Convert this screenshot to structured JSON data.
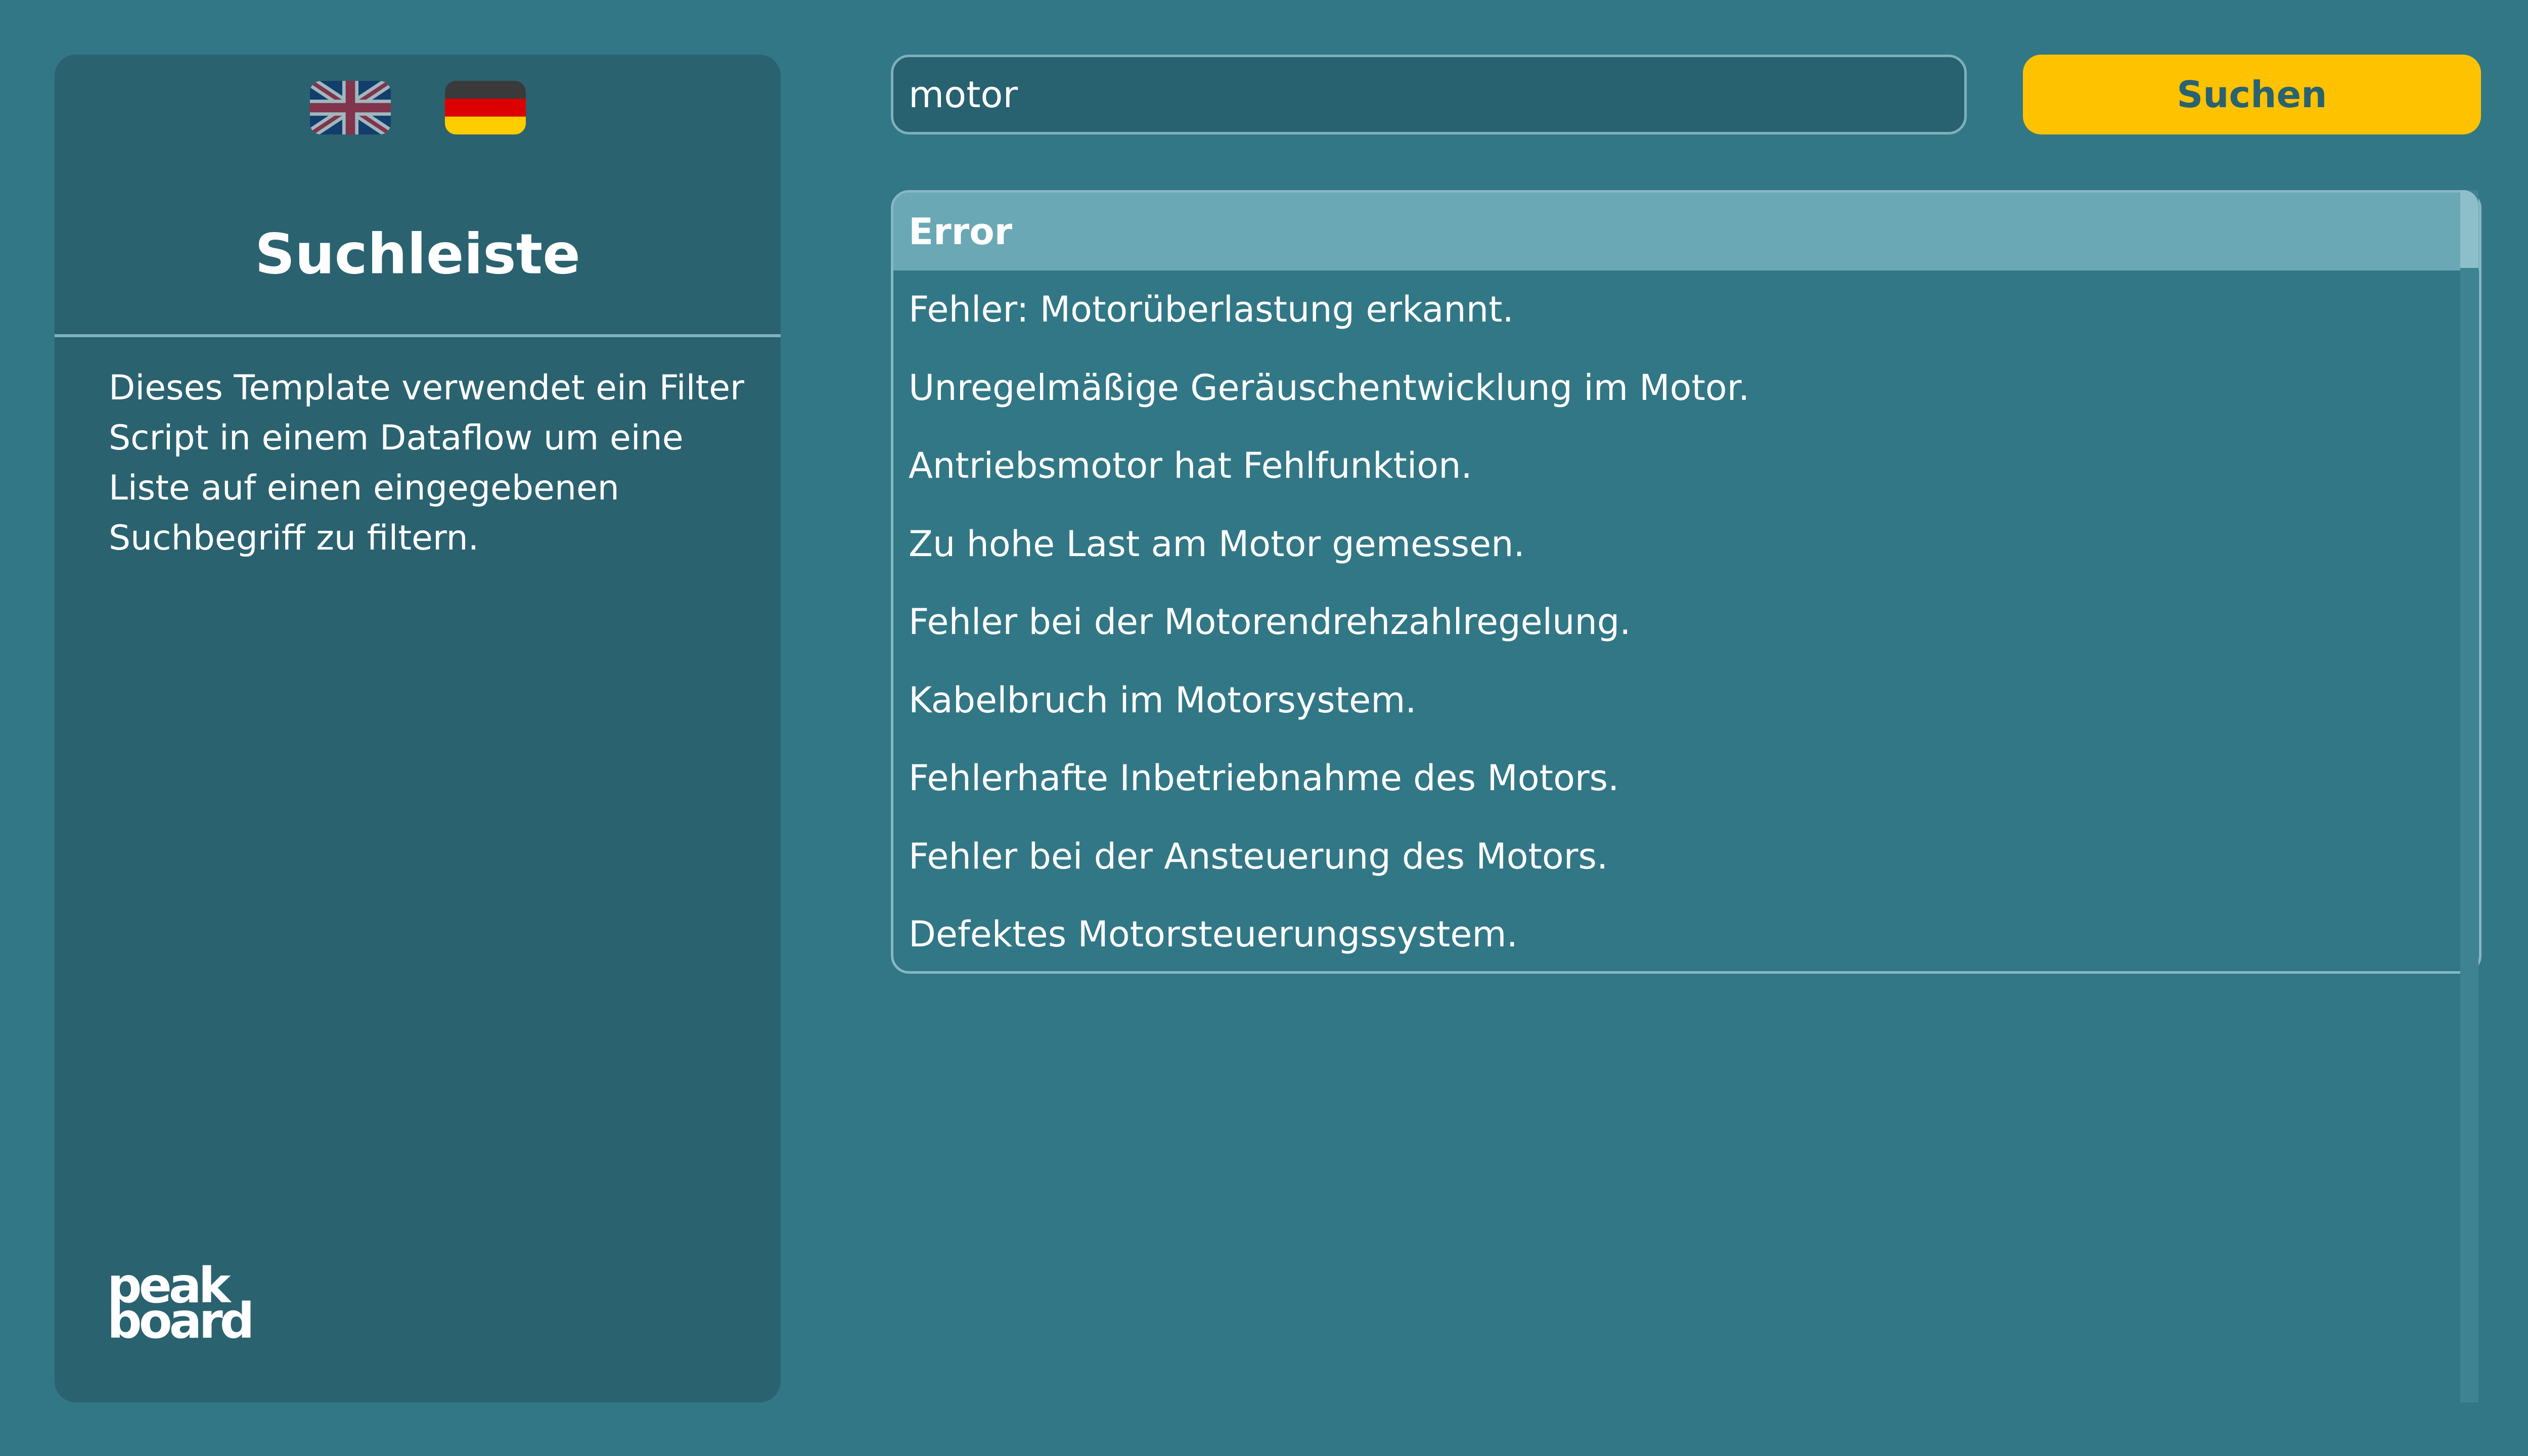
{
  "sidebar": {
    "languages": [
      {
        "code": "en",
        "icon": "uk-flag-icon"
      },
      {
        "code": "de",
        "icon": "germany-flag-icon"
      }
    ],
    "title": "Suchleiste",
    "description": "Dieses Template verwendet ein Filter Script in einem Dataflow um eine Liste auf einen eingegebenen Suchbegriff zu filtern.",
    "logo_line1": "peak",
    "logo_line2": "board"
  },
  "search": {
    "value": "motor",
    "button_label": "Suchen"
  },
  "results": {
    "header": "Error",
    "rows": [
      "Fehler: Motorüberlastung erkannt.",
      "Unregelmäßige Geräuschentwicklung im Motor.",
      "Antriebsmotor hat Fehlfunktion.",
      "Zu hohe Last am Motor gemessen.",
      "Fehler bei der Motorendrehzahlregelung.",
      "Kabelbruch im Motorsystem.",
      "Fehlerhafte Inbetriebnahme des Motors.",
      "Fehler bei der Ansteuerung des Motors.",
      "Defektes Motorsteuerungssystem."
    ]
  },
  "colors": {
    "background": "#327786",
    "panel": "#2a6270",
    "accent": "#ffc200",
    "list_header": "#6aa8b5"
  }
}
